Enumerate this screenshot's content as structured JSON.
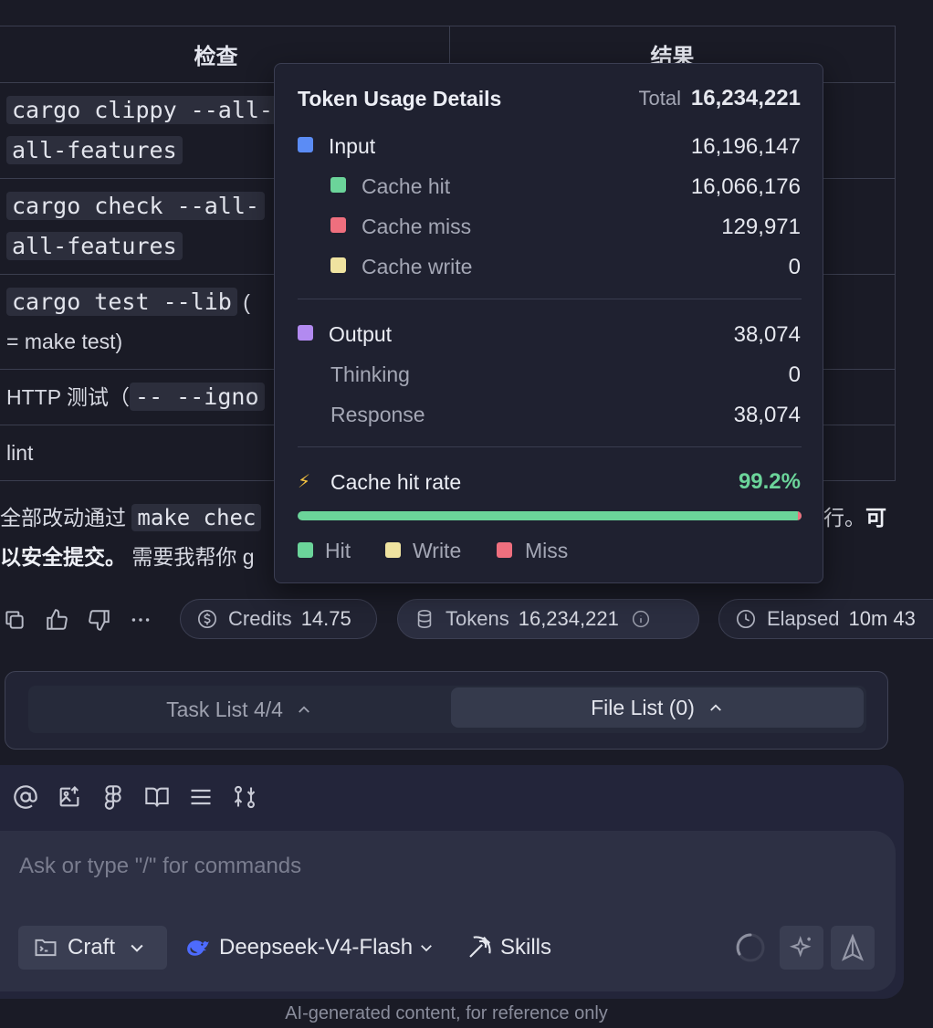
{
  "table": {
    "headers": [
      "检查",
      "结果"
    ],
    "rows": [
      {
        "code1": "cargo clippy --all-",
        "code2": "all-features"
      },
      {
        "code1": "cargo check --all-",
        "code2": "all-features"
      },
      {
        "code1": "cargo test --lib",
        "tail": " (",
        "line2": "= make test)"
      },
      {
        "text": "HTTP 测试（",
        "code1": "-- --igno"
      },
      {
        "text": "lint"
      }
    ]
  },
  "summary": {
    "prefix": "全部改动通过 ",
    "code": "make chec",
    "right_tail": "行。",
    "bold_tail": "可",
    "bold_line2": "以安全提交。",
    "line2_rest": " 需要我帮你 g"
  },
  "popover": {
    "title": "Token Usage Details",
    "total_label": "Total",
    "total_value": "16,234,221",
    "input_label": "Input",
    "input_value": "16,196,147",
    "cache_hit_label": "Cache hit",
    "cache_hit_value": "16,066,176",
    "cache_miss_label": "Cache miss",
    "cache_miss_value": "129,971",
    "cache_write_label": "Cache write",
    "cache_write_value": "0",
    "output_label": "Output",
    "output_value": "38,074",
    "thinking_label": "Thinking",
    "thinking_value": "0",
    "response_label": "Response",
    "response_value": "38,074",
    "rate_label": "Cache hit rate",
    "rate_value": "99.2%",
    "rate_fraction": 0.992,
    "legend_hit": "Hit",
    "legend_write": "Write",
    "legend_miss": "Miss",
    "colors": {
      "input": "#5b8cf5",
      "hit": "#6bd49a",
      "miss": "#ef6f7e",
      "write": "#efe3a0",
      "output": "#b28af0",
      "rate": "#6bd49a"
    }
  },
  "stats": {
    "credits_label": "Credits",
    "credits_value": "14.75",
    "tokens_label": "Tokens",
    "tokens_value": "16,234,221",
    "elapsed_label": "Elapsed",
    "elapsed_value": "10m 43"
  },
  "lists": {
    "task_label": "Task List 4/4",
    "file_label": "File List (0)"
  },
  "composer": {
    "placeholder": "Ask or type \"/\" for commands",
    "mode": "Craft",
    "model": "Deepseek-V4-Flash",
    "skills": "Skills",
    "tools": [
      "at-icon",
      "image-upload-icon",
      "figma-icon",
      "book-icon",
      "list-icon",
      "git-compare-icon"
    ]
  },
  "disclaimer": "AI-generated content, for reference only"
}
